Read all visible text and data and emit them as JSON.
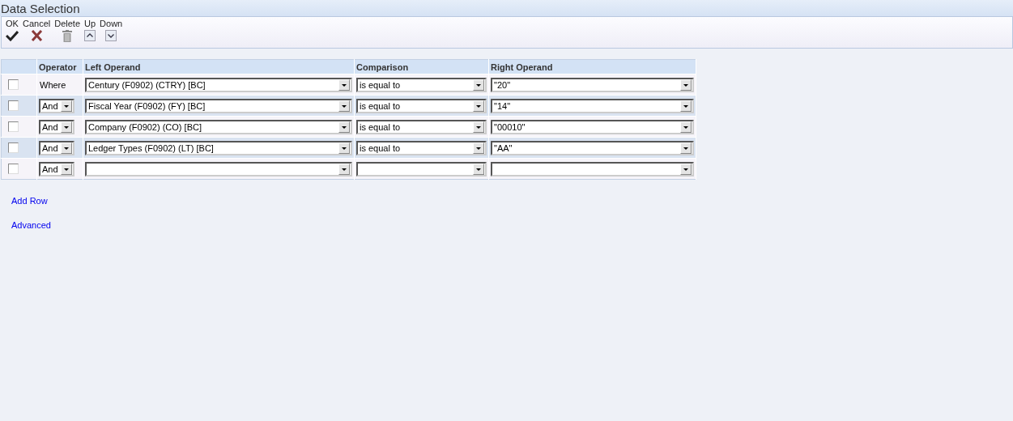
{
  "title": "Data Selection",
  "toolbar": [
    {
      "label": "OK",
      "kind": "check"
    },
    {
      "label": "Cancel",
      "kind": "cross"
    },
    {
      "label": "Delete",
      "kind": "trash"
    },
    {
      "label": "Up",
      "kind": "up"
    },
    {
      "label": "Down",
      "kind": "down"
    }
  ],
  "columns": [
    "Operator",
    "Left Operand",
    "Comparison",
    "Right Operand"
  ],
  "rows": [
    {
      "checked": false,
      "operator": {
        "kind": "text",
        "value": "Where"
      },
      "left": "Century (F0902) (CTRY) [BC]",
      "comparison": "is equal to",
      "right": "\"20\""
    },
    {
      "checked": false,
      "operator": {
        "kind": "select",
        "value": "And"
      },
      "left": "Fiscal Year (F0902) (FY) [BC]",
      "comparison": "is equal to",
      "right": "\"14\""
    },
    {
      "checked": false,
      "operator": {
        "kind": "select",
        "value": "And"
      },
      "left": "Company (F0902) (CO) [BC]",
      "comparison": "is equal to",
      "right": "\"00010\""
    },
    {
      "checked": false,
      "operator": {
        "kind": "select",
        "value": "And"
      },
      "left": "Ledger Types (F0902) (LT) [BC]",
      "comparison": "is equal to",
      "right": "\"AA\""
    },
    {
      "checked": false,
      "operator": {
        "kind": "select",
        "value": "And"
      }
    }
  ],
  "links": [
    "Add Row",
    "Advanced"
  ]
}
